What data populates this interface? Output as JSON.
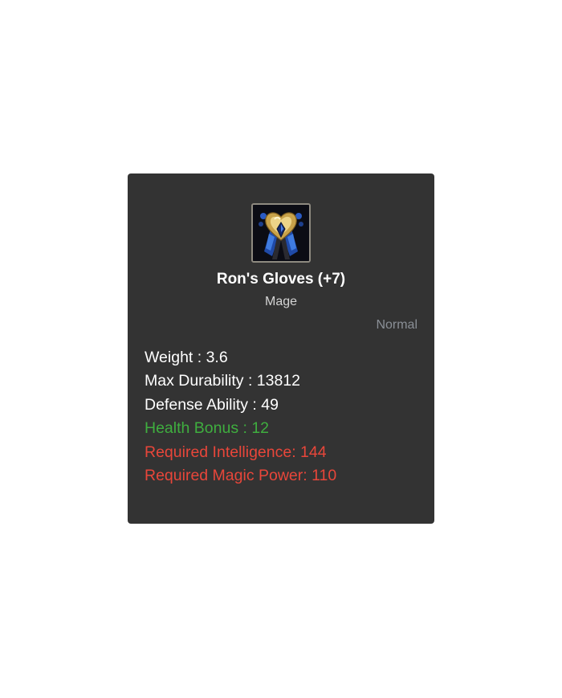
{
  "item": {
    "icon": "gloves-icon",
    "name": "Ron's Gloves (+7)",
    "class": "Mage",
    "grade": "Normal"
  },
  "stats": [
    {
      "text": "Weight : 3.6",
      "color": "#ffffff"
    },
    {
      "text": "Max Durability : 13812",
      "color": "#ffffff"
    },
    {
      "text": "Defense Ability : 49",
      "color": "#ffffff"
    },
    {
      "text": "Health Bonus : 12",
      "color": "#3fae3f"
    },
    {
      "text": "Required Intelligence: 144",
      "color": "#e8463a"
    },
    {
      "text": "Required Magic Power: 110",
      "color": "#e8463a"
    }
  ],
  "colors": {
    "panel_background": "#333333",
    "title_text": "#ffffff",
    "grade_text": "#8a8f96"
  }
}
